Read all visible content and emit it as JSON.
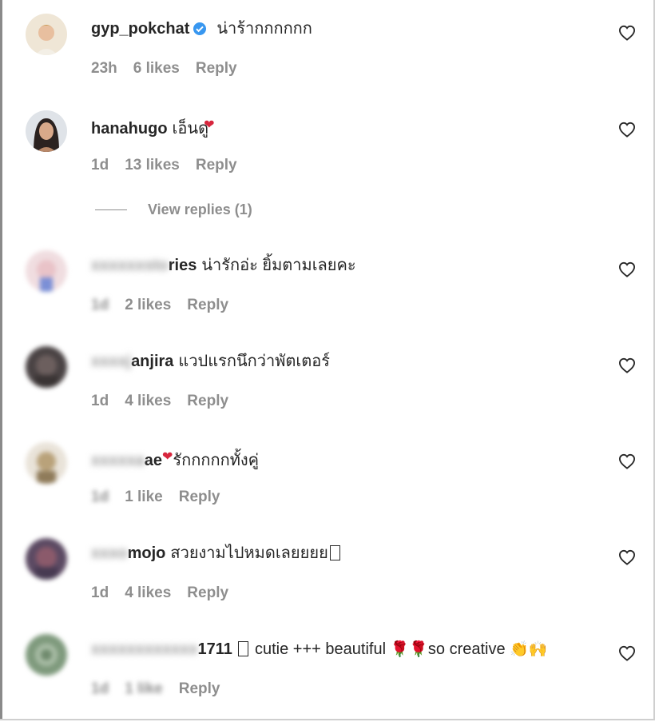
{
  "colors": {
    "text": "#262626",
    "muted": "#8e8e8e",
    "verified": "#3897f0"
  },
  "comments": [
    {
      "user_visible": "gyp_pokchat",
      "user_hidden": "",
      "text": "น่าร้ากกกกกก",
      "time": "23h",
      "likes": "6 likes",
      "reply": "Reply",
      "verified": true
    },
    {
      "user_visible": "hanahugo",
      "user_hidden": "",
      "text": "เอ็นดู",
      "time": "1d",
      "likes": "13 likes",
      "reply": "Reply",
      "verified": false
    },
    {
      "user_visible": "ries",
      "user_hidden": "xxxxxxsto",
      "text": "น่ารักอ่ะ ยิ้มตามเลยคะ",
      "time": "1d",
      "likes": "2 likes",
      "reply": "Reply",
      "verified": false
    },
    {
      "user_visible": "anjira",
      "user_hidden": "xxxxj",
      "text": "แวปแรกนึกว่าพัตเตอร์",
      "time": "1d",
      "likes": "4 likes",
      "reply": "Reply",
      "verified": false
    },
    {
      "user_visible": "ae",
      "user_hidden": "xxxxxa",
      "text": "รักกกกกทั้งคู่",
      "time": "1d",
      "likes": "1 like",
      "reply": "Reply",
      "verified": false
    },
    {
      "user_visible": "mojo",
      "user_hidden": "xxxo",
      "text": "สวยงามไปหมดเลยยยย",
      "time": "1d",
      "likes": "4 likes",
      "reply": "Reply",
      "verified": false
    },
    {
      "user_visible": "1711",
      "user_hidden": "xxxxxxxxxxxx",
      "text": "cutie +++ beautiful",
      "text2": "so creative",
      "time": "1d",
      "likes": "1 like",
      "reply": "Reply",
      "verified": false
    }
  ],
  "view_replies": "View replies (1)",
  "icons": {
    "like": "heart-outline-icon",
    "verified": "verified-badge-icon"
  }
}
